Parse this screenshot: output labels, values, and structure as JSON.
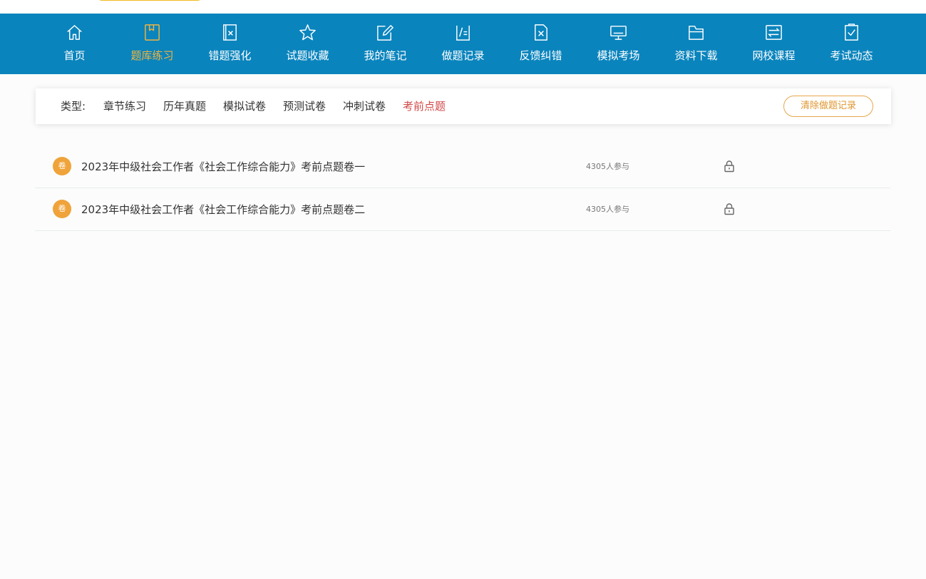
{
  "nav": {
    "items": [
      {
        "label": "首页",
        "icon": "home-icon"
      },
      {
        "label": "题库练习",
        "icon": "book-icon"
      },
      {
        "label": "错题强化",
        "icon": "wrong-questions-icon"
      },
      {
        "label": "试题收藏",
        "icon": "star-icon"
      },
      {
        "label": "我的笔记",
        "icon": "note-edit-icon"
      },
      {
        "label": "做题记录",
        "icon": "record-icon"
      },
      {
        "label": "反馈纠错",
        "icon": "feedback-x-icon"
      },
      {
        "label": "模拟考场",
        "icon": "monitor-icon"
      },
      {
        "label": "资料下载",
        "icon": "folder-icon"
      },
      {
        "label": "网校课程",
        "icon": "course-icon"
      },
      {
        "label": "考试动态",
        "icon": "checklist-icon"
      }
    ],
    "active_index": 1,
    "active_color": "#f2b43e",
    "bar_color": "#0a84bd"
  },
  "filter": {
    "prefix": "类型:",
    "options": [
      "章节练习",
      "历年真题",
      "模拟试卷",
      "预测试卷",
      "冲刺试卷",
      "考前点题"
    ],
    "active_index": 5,
    "active_color": "#d24747",
    "clear_button": "清除做题记录"
  },
  "papers": [
    {
      "badge": "卷",
      "title": "2023年中级社会工作者《社会工作综合能力》考前点题卷一",
      "participants": "4305人参与",
      "icon": "lock-icon"
    },
    {
      "badge": "卷",
      "title": "2023年中级社会工作者《社会工作综合能力》考前点题卷二",
      "participants": "4305人参与",
      "icon": "lock-icon"
    }
  ]
}
